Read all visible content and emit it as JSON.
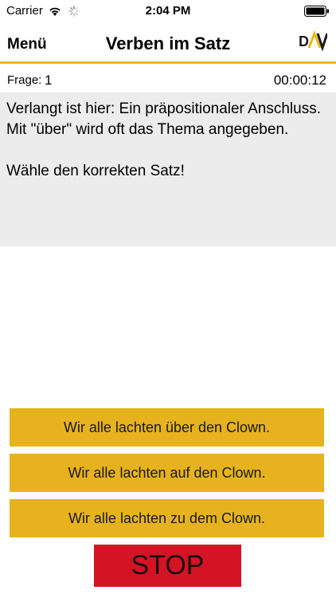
{
  "status_bar": {
    "carrier": "Carrier",
    "time": "2:04 PM",
    "wifi_icon": "wifi-icon",
    "activity_icon": "spinner-icon",
    "battery_icon": "battery-icon"
  },
  "nav": {
    "menu_label": "Menü",
    "title": "Verben im Satz",
    "logo_text": "DAV",
    "accent_color": "#e8b917"
  },
  "question": {
    "frage_label": "Frage:",
    "number": "1",
    "timer": "00:00:12",
    "text": "Verlangt ist hier: Ein präpositionaler Anschluss. Mit \"über\" wird oft das Thema angegeben.",
    "instruction": "Wähle den korrekten Satz!"
  },
  "answers": [
    {
      "label": "Wir alle lachten über den Clown."
    },
    {
      "label": "Wir alle lachten auf den Clown."
    },
    {
      "label": "Wir alle lachten zu dem Clown."
    }
  ],
  "stop": {
    "label": "STOP",
    "color": "#d21425"
  },
  "colors": {
    "answer_button": "#e6b21e",
    "question_background": "#ececec"
  }
}
